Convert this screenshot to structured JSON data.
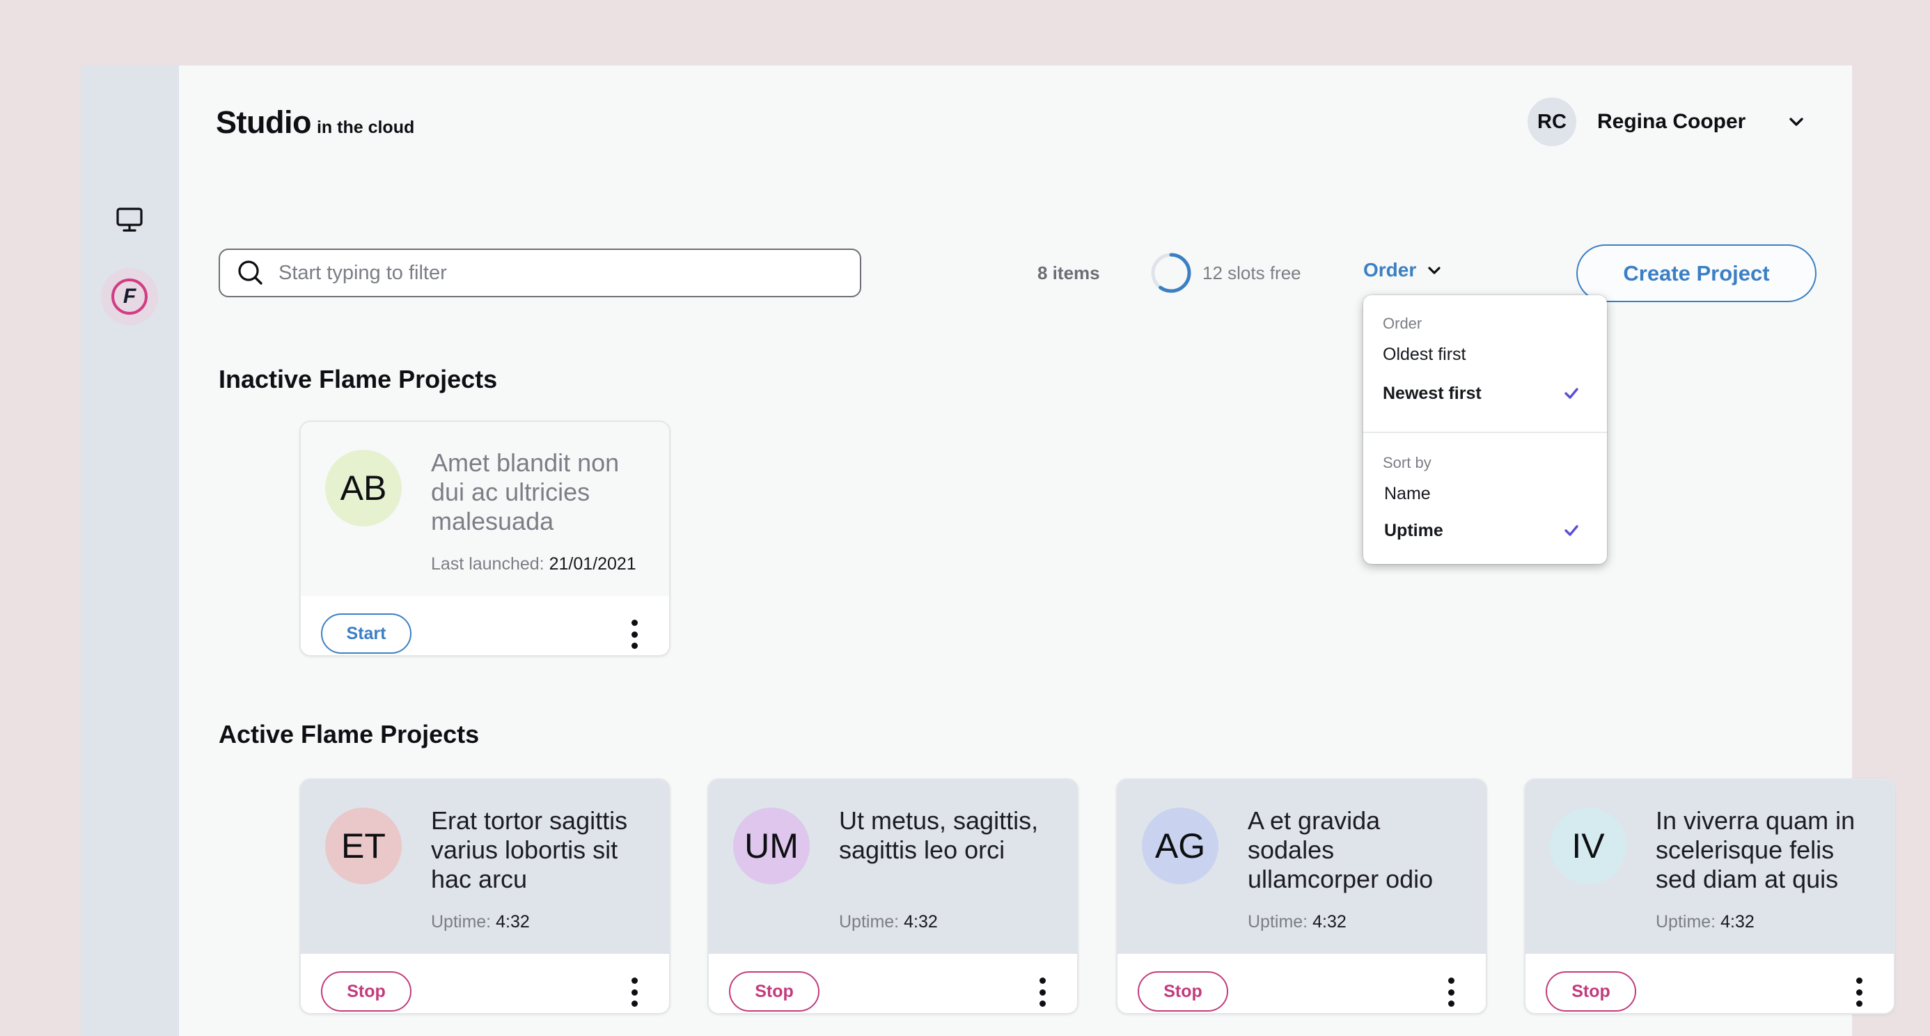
{
  "app": {
    "title": "Studio",
    "subtitle": "in the cloud"
  },
  "sidebar": {
    "items": [
      {
        "icon": "monitor-icon",
        "label": "Workstations"
      },
      {
        "icon": "flame-icon",
        "label": "Flame",
        "active": true
      }
    ]
  },
  "user": {
    "initials": "RC",
    "name": "Regina Cooper"
  },
  "toolbar": {
    "search_placeholder": "Start typing to filter",
    "search_value": "",
    "items_count": "8 items",
    "slots_label": "12 slots free",
    "slots_used_fraction": 0.6,
    "order_label": "Order",
    "create_label": "Create Project"
  },
  "order_menu": {
    "open": true,
    "order_heading": "Order",
    "order_options": [
      {
        "label": "Oldest first",
        "selected": false
      },
      {
        "label": "Newest first",
        "selected": true
      }
    ],
    "sort_heading": "Sort by",
    "sort_options": [
      {
        "label": "Name",
        "selected": false
      },
      {
        "label": "Uptime",
        "selected": true
      }
    ]
  },
  "colors": {
    "accent_blue": "#3b7fc4",
    "stop_pink": "#c23b7c",
    "check_purple": "#5a4fd6",
    "flame_pink": "#d23c85"
  },
  "inactive": {
    "heading": "Inactive Flame Projects",
    "projects": [
      {
        "initials": "AB",
        "avatar_color": "#e6f1cf",
        "title": "Amet blandit non dui ac ultricies malesuada",
        "meta_label": "Last launched:",
        "meta_value": "21/01/2021",
        "action": "Start"
      }
    ]
  },
  "active": {
    "heading": "Active Flame Projects",
    "projects": [
      {
        "initials": "ET",
        "avatar_color": "#eac7c8",
        "title": "Erat tortor sagittis varius lobortis sit hac arcu",
        "meta_label": "Uptime:",
        "meta_value": "4:32",
        "action": "Stop"
      },
      {
        "initials": "UM",
        "avatar_color": "#dec6ec",
        "title": "Ut metus, sagittis, sagittis leo orci",
        "meta_label": "Uptime:",
        "meta_value": "4:32",
        "action": "Stop"
      },
      {
        "initials": "AG",
        "avatar_color": "#c9d3ef",
        "title": "A et gravida sodales ullamcorper odio",
        "meta_label": "Uptime:",
        "meta_value": "4:32",
        "action": "Stop"
      },
      {
        "initials": "IV",
        "avatar_color": "#d5ebf0",
        "title": "In viverra quam in scelerisque felis sed diam at quis",
        "meta_label": "Uptime:",
        "meta_value": "4:32",
        "action": "Stop"
      }
    ]
  }
}
